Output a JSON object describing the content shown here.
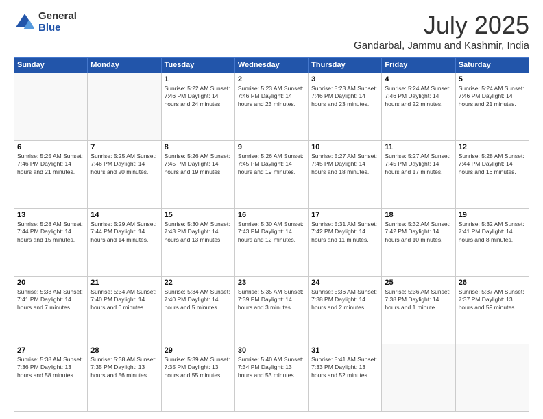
{
  "header": {
    "logo_general": "General",
    "logo_blue": "Blue",
    "month": "July 2025",
    "location": "Gandarbal, Jammu and Kashmir, India"
  },
  "columns": [
    "Sunday",
    "Monday",
    "Tuesday",
    "Wednesday",
    "Thursday",
    "Friday",
    "Saturday"
  ],
  "weeks": [
    [
      {
        "day": "",
        "info": ""
      },
      {
        "day": "",
        "info": ""
      },
      {
        "day": "1",
        "info": "Sunrise: 5:22 AM\nSunset: 7:46 PM\nDaylight: 14 hours and 24 minutes."
      },
      {
        "day": "2",
        "info": "Sunrise: 5:23 AM\nSunset: 7:46 PM\nDaylight: 14 hours and 23 minutes."
      },
      {
        "day": "3",
        "info": "Sunrise: 5:23 AM\nSunset: 7:46 PM\nDaylight: 14 hours and 23 minutes."
      },
      {
        "day": "4",
        "info": "Sunrise: 5:24 AM\nSunset: 7:46 PM\nDaylight: 14 hours and 22 minutes."
      },
      {
        "day": "5",
        "info": "Sunrise: 5:24 AM\nSunset: 7:46 PM\nDaylight: 14 hours and 21 minutes."
      }
    ],
    [
      {
        "day": "6",
        "info": "Sunrise: 5:25 AM\nSunset: 7:46 PM\nDaylight: 14 hours and 21 minutes."
      },
      {
        "day": "7",
        "info": "Sunrise: 5:25 AM\nSunset: 7:46 PM\nDaylight: 14 hours and 20 minutes."
      },
      {
        "day": "8",
        "info": "Sunrise: 5:26 AM\nSunset: 7:45 PM\nDaylight: 14 hours and 19 minutes."
      },
      {
        "day": "9",
        "info": "Sunrise: 5:26 AM\nSunset: 7:45 PM\nDaylight: 14 hours and 19 minutes."
      },
      {
        "day": "10",
        "info": "Sunrise: 5:27 AM\nSunset: 7:45 PM\nDaylight: 14 hours and 18 minutes."
      },
      {
        "day": "11",
        "info": "Sunrise: 5:27 AM\nSunset: 7:45 PM\nDaylight: 14 hours and 17 minutes."
      },
      {
        "day": "12",
        "info": "Sunrise: 5:28 AM\nSunset: 7:44 PM\nDaylight: 14 hours and 16 minutes."
      }
    ],
    [
      {
        "day": "13",
        "info": "Sunrise: 5:28 AM\nSunset: 7:44 PM\nDaylight: 14 hours and 15 minutes."
      },
      {
        "day": "14",
        "info": "Sunrise: 5:29 AM\nSunset: 7:44 PM\nDaylight: 14 hours and 14 minutes."
      },
      {
        "day": "15",
        "info": "Sunrise: 5:30 AM\nSunset: 7:43 PM\nDaylight: 14 hours and 13 minutes."
      },
      {
        "day": "16",
        "info": "Sunrise: 5:30 AM\nSunset: 7:43 PM\nDaylight: 14 hours and 12 minutes."
      },
      {
        "day": "17",
        "info": "Sunrise: 5:31 AM\nSunset: 7:42 PM\nDaylight: 14 hours and 11 minutes."
      },
      {
        "day": "18",
        "info": "Sunrise: 5:32 AM\nSunset: 7:42 PM\nDaylight: 14 hours and 10 minutes."
      },
      {
        "day": "19",
        "info": "Sunrise: 5:32 AM\nSunset: 7:41 PM\nDaylight: 14 hours and 8 minutes."
      }
    ],
    [
      {
        "day": "20",
        "info": "Sunrise: 5:33 AM\nSunset: 7:41 PM\nDaylight: 14 hours and 7 minutes."
      },
      {
        "day": "21",
        "info": "Sunrise: 5:34 AM\nSunset: 7:40 PM\nDaylight: 14 hours and 6 minutes."
      },
      {
        "day": "22",
        "info": "Sunrise: 5:34 AM\nSunset: 7:40 PM\nDaylight: 14 hours and 5 minutes."
      },
      {
        "day": "23",
        "info": "Sunrise: 5:35 AM\nSunset: 7:39 PM\nDaylight: 14 hours and 3 minutes."
      },
      {
        "day": "24",
        "info": "Sunrise: 5:36 AM\nSunset: 7:38 PM\nDaylight: 14 hours and 2 minutes."
      },
      {
        "day": "25",
        "info": "Sunrise: 5:36 AM\nSunset: 7:38 PM\nDaylight: 14 hours and 1 minute."
      },
      {
        "day": "26",
        "info": "Sunrise: 5:37 AM\nSunset: 7:37 PM\nDaylight: 13 hours and 59 minutes."
      }
    ],
    [
      {
        "day": "27",
        "info": "Sunrise: 5:38 AM\nSunset: 7:36 PM\nDaylight: 13 hours and 58 minutes."
      },
      {
        "day": "28",
        "info": "Sunrise: 5:38 AM\nSunset: 7:35 PM\nDaylight: 13 hours and 56 minutes."
      },
      {
        "day": "29",
        "info": "Sunrise: 5:39 AM\nSunset: 7:35 PM\nDaylight: 13 hours and 55 minutes."
      },
      {
        "day": "30",
        "info": "Sunrise: 5:40 AM\nSunset: 7:34 PM\nDaylight: 13 hours and 53 minutes."
      },
      {
        "day": "31",
        "info": "Sunrise: 5:41 AM\nSunset: 7:33 PM\nDaylight: 13 hours and 52 minutes."
      },
      {
        "day": "",
        "info": ""
      },
      {
        "day": "",
        "info": ""
      }
    ]
  ]
}
